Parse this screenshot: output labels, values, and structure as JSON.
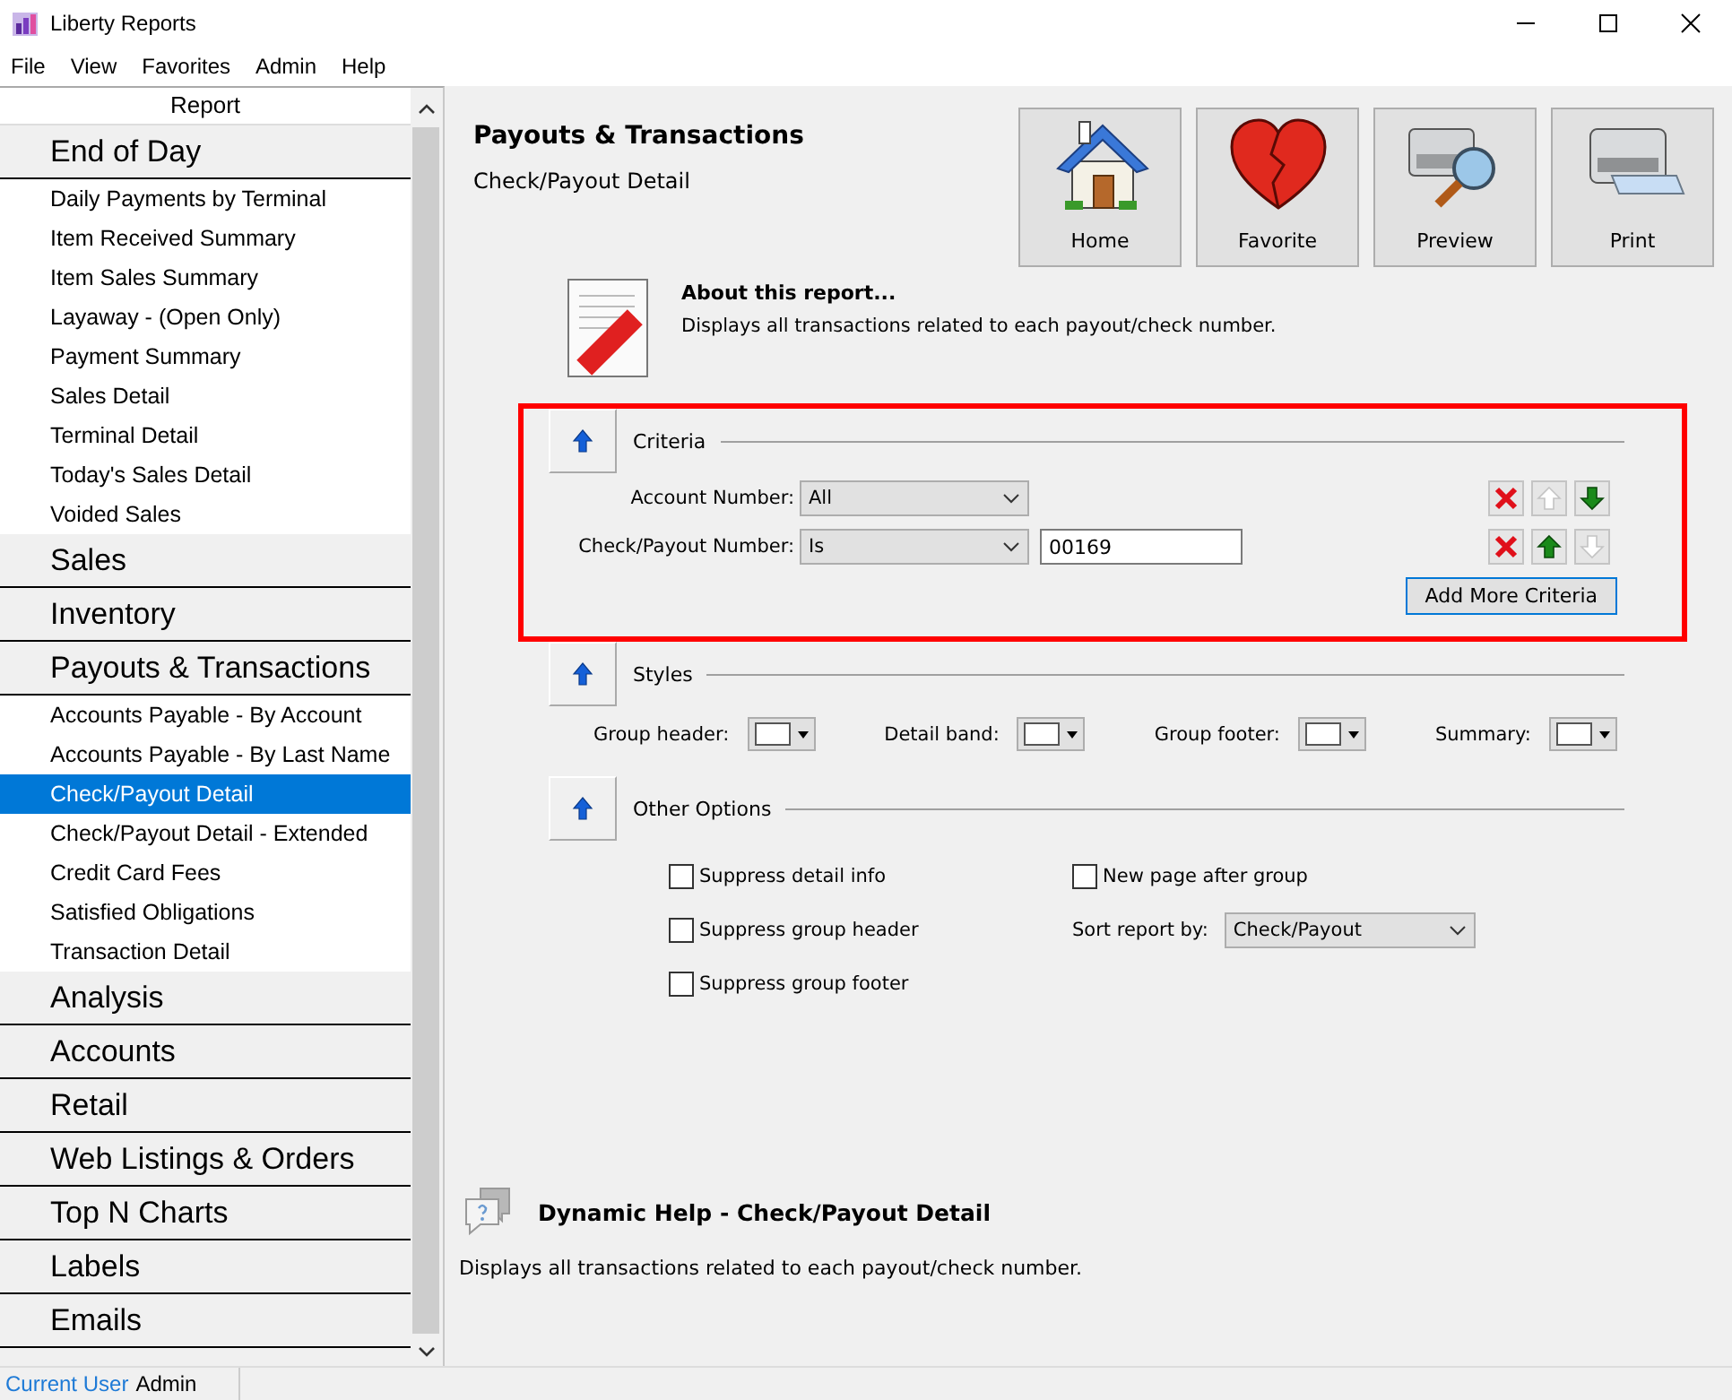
{
  "window": {
    "title": "Liberty Reports"
  },
  "menu": [
    "File",
    "View",
    "Favorites",
    "Admin",
    "Help"
  ],
  "sidebar": {
    "header": "Report",
    "groups": [
      {
        "label": "End of Day",
        "items": [
          {
            "label": "Daily Payments by Terminal",
            "selected": false
          },
          {
            "label": "Item Received Summary",
            "selected": false
          },
          {
            "label": "Item Sales Summary",
            "selected": false
          },
          {
            "label": "Layaway - (Open Only)",
            "selected": false
          },
          {
            "label": "Payment Summary",
            "selected": false
          },
          {
            "label": "Sales Detail",
            "selected": false
          },
          {
            "label": "Terminal Detail",
            "selected": false
          },
          {
            "label": "Today's Sales Detail",
            "selected": false
          },
          {
            "label": "Voided Sales",
            "selected": false
          }
        ]
      },
      {
        "label": "Sales"
      },
      {
        "label": "Inventory"
      },
      {
        "label": "Payouts & Transactions",
        "items": [
          {
            "label": "Accounts Payable - By Account",
            "selected": false
          },
          {
            "label": "Accounts Payable - By Last Name",
            "selected": false
          },
          {
            "label": "Check/Payout Detail",
            "selected": true
          },
          {
            "label": "Check/Payout Detail - Extended",
            "selected": false
          },
          {
            "label": "Credit Card Fees",
            "selected": false
          },
          {
            "label": "Satisfied Obligations",
            "selected": false
          },
          {
            "label": "Transaction Detail",
            "selected": false
          }
        ]
      },
      {
        "label": "Analysis"
      },
      {
        "label": "Accounts"
      },
      {
        "label": "Retail"
      },
      {
        "label": "Web Listings & Orders"
      },
      {
        "label": "Top N Charts"
      },
      {
        "label": "Labels"
      },
      {
        "label": "Emails"
      }
    ]
  },
  "header": {
    "title": "Payouts & Transactions",
    "subtitle": "Check/Payout Detail"
  },
  "toolbar": [
    {
      "kind": "home",
      "label": "Home"
    },
    {
      "kind": "favorite",
      "label": "Favorite"
    },
    {
      "kind": "preview",
      "label": "Preview"
    },
    {
      "kind": "print",
      "label": "Print"
    }
  ],
  "about": {
    "title": "About this report...",
    "text": "Displays all transactions related to each payout/check number."
  },
  "criteria": {
    "label": "Criteria",
    "highlighted": true,
    "rows": [
      {
        "label": "Account Number:",
        "operator": "All",
        "up_enabled": false,
        "down_enabled": true
      },
      {
        "label": "Check/Payout Number:",
        "operator": "Is",
        "value": "00169",
        "up_enabled": true,
        "down_enabled": false
      }
    ],
    "add_button": "Add More Criteria"
  },
  "styles": {
    "label": "Styles",
    "items": [
      {
        "label": "Group header:",
        "color": "#ffffff"
      },
      {
        "label": "Detail band:",
        "color": "#ffffff"
      },
      {
        "label": "Group footer:",
        "color": "#ffffff"
      },
      {
        "label": "Summary:",
        "color": "#ffffff"
      }
    ]
  },
  "other_options": {
    "label": "Other Options",
    "checkboxes": [
      {
        "label": "Suppress detail info",
        "checked": false
      },
      {
        "label": "Suppress group header",
        "checked": false
      },
      {
        "label": "Suppress group footer",
        "checked": false
      },
      {
        "label": "New page after group",
        "checked": false
      }
    ],
    "sort_label": "Sort report by:",
    "sort_value": "Check/Payout"
  },
  "dynamic_help": {
    "title": "Dynamic Help - Check/Payout Detail",
    "text": "Displays all transactions related to each payout/check number."
  },
  "status_bar": {
    "label": "Current User",
    "user": "Admin"
  }
}
